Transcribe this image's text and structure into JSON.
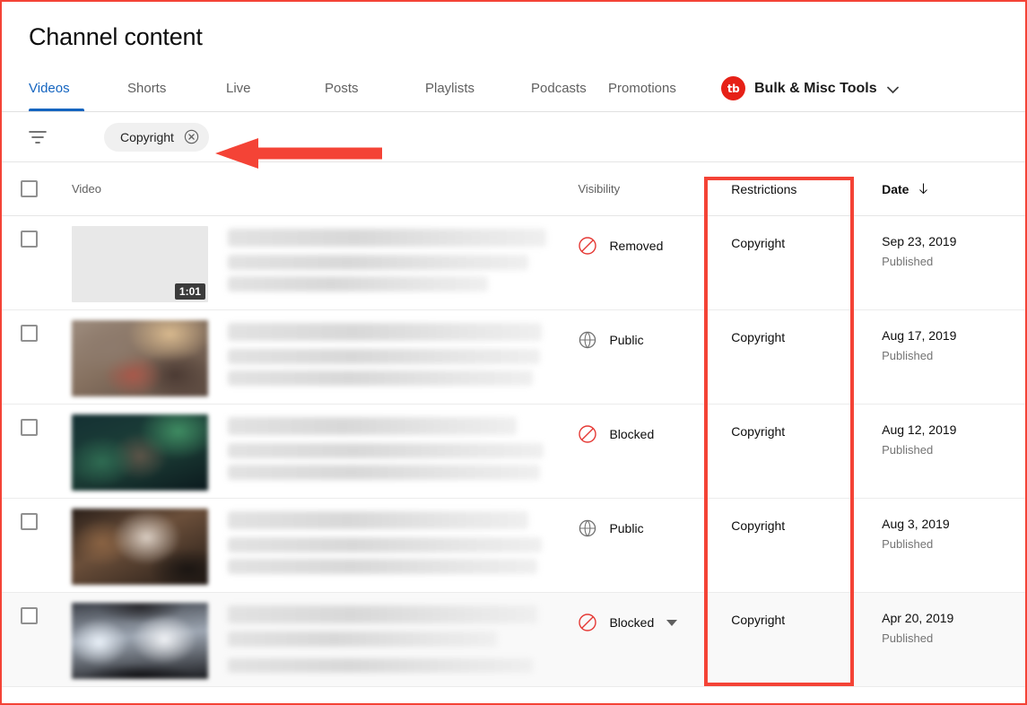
{
  "page": {
    "title": "Channel content"
  },
  "tabs": [
    {
      "label": "Videos",
      "active": true
    },
    {
      "label": "Shorts",
      "active": false
    },
    {
      "label": "Live",
      "active": false
    },
    {
      "label": "Posts",
      "active": false
    },
    {
      "label": "Playlists",
      "active": false
    },
    {
      "label": "Podcasts",
      "active": false
    },
    {
      "label": "Promotions",
      "active": false
    }
  ],
  "tb_menu": {
    "logo_text": "tb",
    "label": "Bulk & Misc Tools",
    "icon": "chevron-down-icon"
  },
  "filter_bar": {
    "filter_icon": "filter-icon",
    "chip": {
      "label": "Copyright",
      "remove_icon": "close-circle-icon"
    }
  },
  "table": {
    "headers": {
      "video": "Video",
      "visibility": "Visibility",
      "restrictions": "Restrictions",
      "date": "Date",
      "date_sort_icon": "arrow-down-icon"
    },
    "rows": [
      {
        "duration": "1:01",
        "thumb": "placeholder",
        "visibility": "Removed",
        "visibility_icon": "blocked-icon",
        "has_caret": false,
        "restrictions": "Copyright",
        "date": "Sep 23, 2019",
        "date_status": "Published",
        "hover": false
      },
      {
        "duration": "",
        "thumb": "warm",
        "visibility": "Public",
        "visibility_icon": "globe-icon",
        "has_caret": false,
        "restrictions": "Copyright",
        "date": "Aug 17, 2019",
        "date_status": "Published",
        "hover": false
      },
      {
        "duration": "",
        "thumb": "teal",
        "visibility": "Blocked",
        "visibility_icon": "blocked-icon",
        "has_caret": false,
        "restrictions": "Copyright",
        "date": "Aug 12, 2019",
        "date_status": "Published",
        "hover": false
      },
      {
        "duration": "",
        "thumb": "brown",
        "visibility": "Public",
        "visibility_icon": "globe-icon",
        "has_caret": false,
        "restrictions": "Copyright",
        "date": "Aug 3, 2019",
        "date_status": "Published",
        "hover": false
      },
      {
        "duration": "",
        "thumb": "bright",
        "visibility": "Blocked",
        "visibility_icon": "blocked-icon",
        "has_caret": true,
        "restrictions": "Copyright",
        "date": "Apr 20, 2019",
        "date_status": "Published",
        "hover": true
      }
    ]
  },
  "annotations": {
    "arrow_color": "#f44336",
    "highlight_color": "#f44336",
    "arrow_target": "filter chip",
    "highlight_target": "Restrictions column"
  },
  "colors": {
    "accent_blue": "#1565c0",
    "brand_red": "#e62117",
    "annotation_red": "#f44336",
    "removed_icon": "#e53935"
  }
}
